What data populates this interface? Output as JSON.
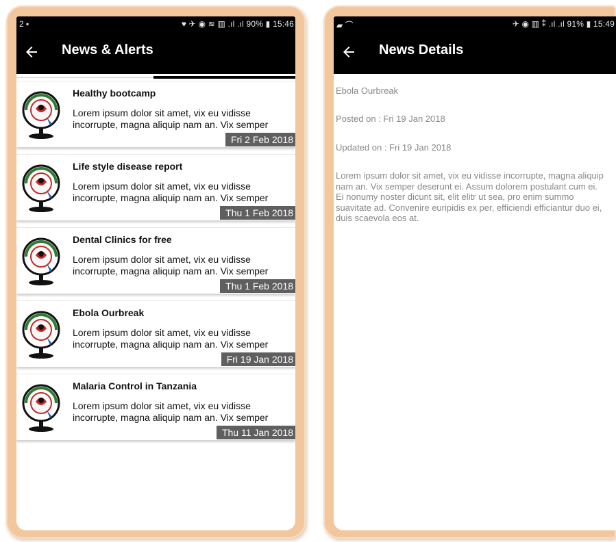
{
  "left_screen": {
    "status": {
      "left": "2 ▪",
      "right": "♥ ✈ ◉ ≋ ▥ .ıl .ıl 90% ▮ 15:46"
    },
    "appbar": {
      "title": "News & Alerts",
      "back_icon": "arrow-left-icon"
    },
    "items": [
      {
        "title": "Healthy bootcamp",
        "summary": "Lorem ipsum dolor sit amet, vix eu vidisse incorrupte, magna aliquip nam an. Vix semper",
        "date": "Fri 2 Feb 2018"
      },
      {
        "title": "Life style disease report",
        "summary": "Lorem ipsum dolor sit amet, vix eu vidisse incorrupte, magna aliquip nam an. Vix semper",
        "date": "Thu 1 Feb 2018"
      },
      {
        "title": "Dental Clinics for free",
        "summary": "Lorem ipsum dolor sit amet, vix eu vidisse incorrupte, magna aliquip nam an. Vix semper",
        "date": "Thu 1 Feb 2018"
      },
      {
        "title": "Ebola Ourbreak",
        "summary": "Lorem ipsum dolor sit amet, vix eu vidisse incorrupte, magna aliquip nam an. Vix semper",
        "date": "Fri 19 Jan 2018"
      },
      {
        "title": "Malaria Control in Tanzania",
        "summary": "Lorem ipsum dolor sit amet, vix eu vidisse incorrupte, magna aliquip nam an. Vix semper",
        "date": "Thu 11 Jan 2018"
      }
    ]
  },
  "right_screen": {
    "status": {
      "left": "▰ ⌒",
      "right": "✈ ◉ ▥ ⁑ .ıl .ıl 91% ▮ 15:49"
    },
    "appbar": {
      "title": "News Details",
      "back_icon": "arrow-left-icon"
    },
    "detail": {
      "title": "Ebola Ourbreak",
      "posted": "Posted on : Fri 19 Jan 2018",
      "updated": "Updated on : Fri 19 Jan 2018",
      "body": "Lorem ipsum dolor sit amet, vix eu vidisse incorrupte, magna aliquip nam an. Vix semper deserunt ei. Assum dolorem postulant cum ei. Ei nonumy noster dicunt sit, elit elitr ut sea, pro enim summo suavitate ad. Convenire euripidis ex per, efficiendi efficiantur duo ei, duis scaevola eos at."
    }
  },
  "colors": {
    "appbar": "#000000",
    "frame": "#f3c79d",
    "date_badge": "#5f5f5f",
    "detail_text": "#888888"
  }
}
